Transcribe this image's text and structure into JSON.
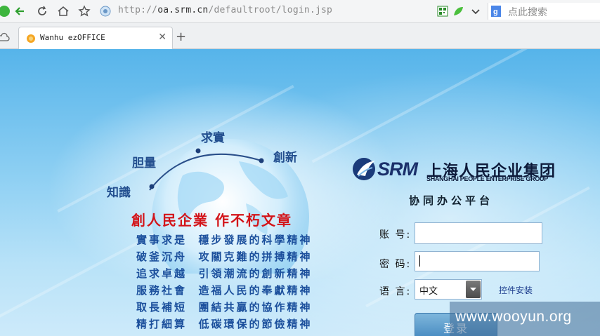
{
  "browser": {
    "url_host": "oa.srm.cn",
    "url_prefix": "http://",
    "url_path": "/defaultroot/login.jsp",
    "search_placeholder": "点此搜索",
    "tab_title": "Wanhu ezOFFICE"
  },
  "hero": {
    "arc_words": [
      "知識",
      "胆量",
      "求實",
      "創新"
    ],
    "slogan": "創人民企業  作不朽文章",
    "rows": [
      [
        "實事求是",
        "穩步發展的科學精神"
      ],
      [
        "破釜沉舟",
        "攻關克難的拼搏精神"
      ],
      [
        "追求卓越",
        "引領潮流的創新精神"
      ],
      [
        "服務社會",
        "造福人民的奉獻精神"
      ],
      [
        "取長補短",
        "團結共贏的協作精神"
      ],
      [
        "精打細算",
        "低碳環保的節儉精神"
      ]
    ]
  },
  "login": {
    "logo_mark": "SRM",
    "company_cn": "上海人民企业集团",
    "company_en": "SHANGHAI PEOPLE ENTERPRISE GROUP",
    "platform_title": "协同办公平台",
    "account_label": "账 号:",
    "account_value": "",
    "password_label": "密 码:",
    "password_value": "",
    "language_label": "语 言:",
    "language_value": "中文",
    "plugin_link": "控件安装",
    "submit_label": "登录"
  },
  "watermark": "www.wooyun.org",
  "colors": {
    "slogan": "#d31419",
    "rows": "#1b4f9c",
    "page_top": "#56b4ea",
    "login_button": "#3f84bd"
  }
}
